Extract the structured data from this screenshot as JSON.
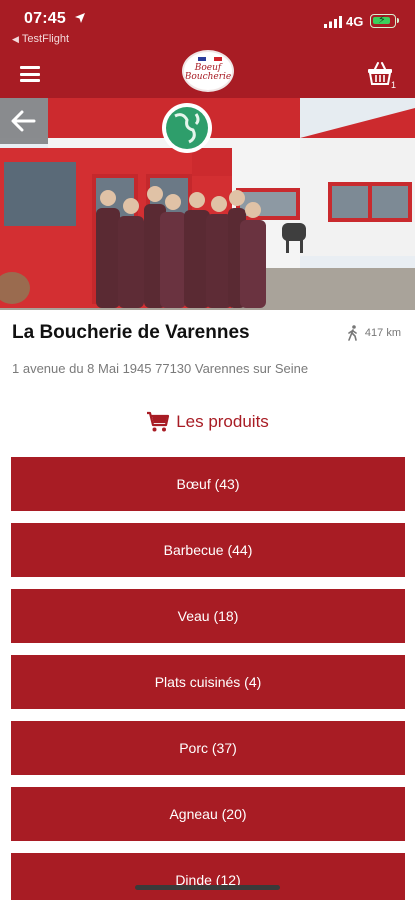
{
  "status_bar": {
    "time": "07:45",
    "back_app_label": "TestFlight",
    "network": "4G"
  },
  "header": {
    "logo_text": "Boeuf Boucherie",
    "cart_count": "1"
  },
  "shop": {
    "name": "La Boucherie de Varennes",
    "distance": "417 km",
    "address": "1 avenue du 8 Mai 1945 77130 Varennes sur Seine"
  },
  "products": {
    "title": "Les produits",
    "categories": [
      {
        "label": "Bœuf (43)"
      },
      {
        "label": "Barbecue (44)"
      },
      {
        "label": "Veau (18)"
      },
      {
        "label": "Plats cuisinés (4)"
      },
      {
        "label": "Porc (37)"
      },
      {
        "label": "Agneau (20)"
      },
      {
        "label": "Dinde (12)"
      }
    ]
  },
  "colors": {
    "brand_red": "#a81c24",
    "battery_green": "#3ad15b"
  },
  "icons": [
    "location-arrow-icon",
    "signal-icon",
    "battery-icon",
    "menu-icon",
    "basket-icon",
    "back-arrow-icon",
    "walking-person-icon",
    "cart-icon",
    "globe-icon"
  ]
}
